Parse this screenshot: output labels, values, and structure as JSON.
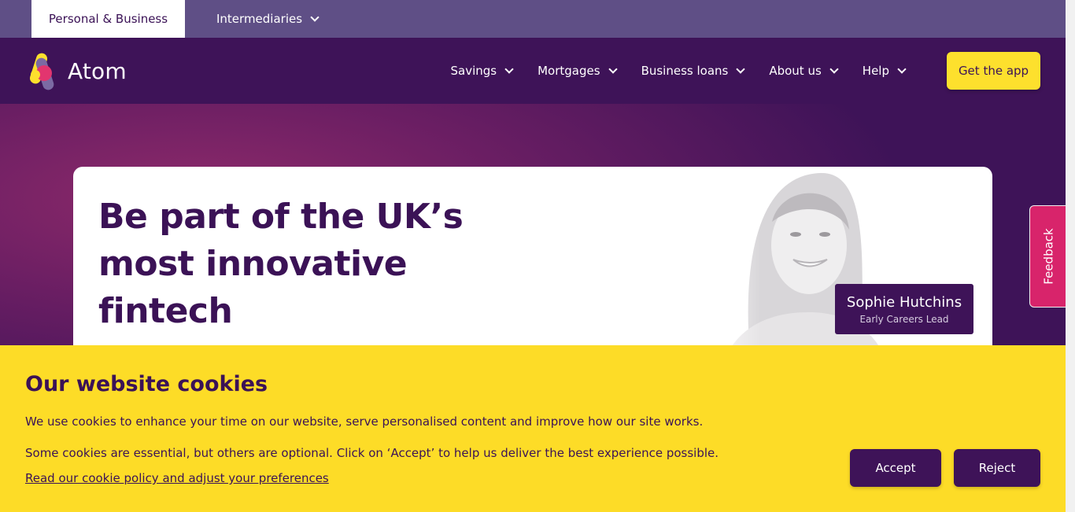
{
  "utility_bar": {
    "tabs": [
      {
        "label": "Personal & Business",
        "active": true
      },
      {
        "label": "Intermediaries",
        "active": false
      }
    ]
  },
  "nav": {
    "brand": "Atom",
    "items": [
      {
        "label": "Savings"
      },
      {
        "label": "Mortgages"
      },
      {
        "label": "Business loans"
      },
      {
        "label": "About us"
      },
      {
        "label": "Help"
      }
    ],
    "cta_label": "Get the app"
  },
  "hero": {
    "title": "Be part of the UK’s most innovative fintech",
    "person_name": "Sophie Hutchins",
    "person_role": "Early Careers Lead"
  },
  "feedback": {
    "label": "Feedback"
  },
  "cookie_banner": {
    "title": "Our website cookies",
    "paragraph_1": "We use cookies to enhance your time on our website, serve personalised content and improve how our site works.",
    "paragraph_2": "Some cookies are essential, but others are optional. Click on ‘Accept’ to help us deliver the best experience possible.",
    "policy_link": "Read our cookie policy and adjust your preferences",
    "accept_label": "Accept",
    "reject_label": "Reject"
  },
  "colors": {
    "brand_purple": "#3e1358",
    "utility_purple": "#5f4f86",
    "accent_yellow": "#fddc27",
    "feedback_pink": "#d8246b"
  },
  "icons": [
    "atom-logo-icon",
    "chevron-down-icon"
  ]
}
